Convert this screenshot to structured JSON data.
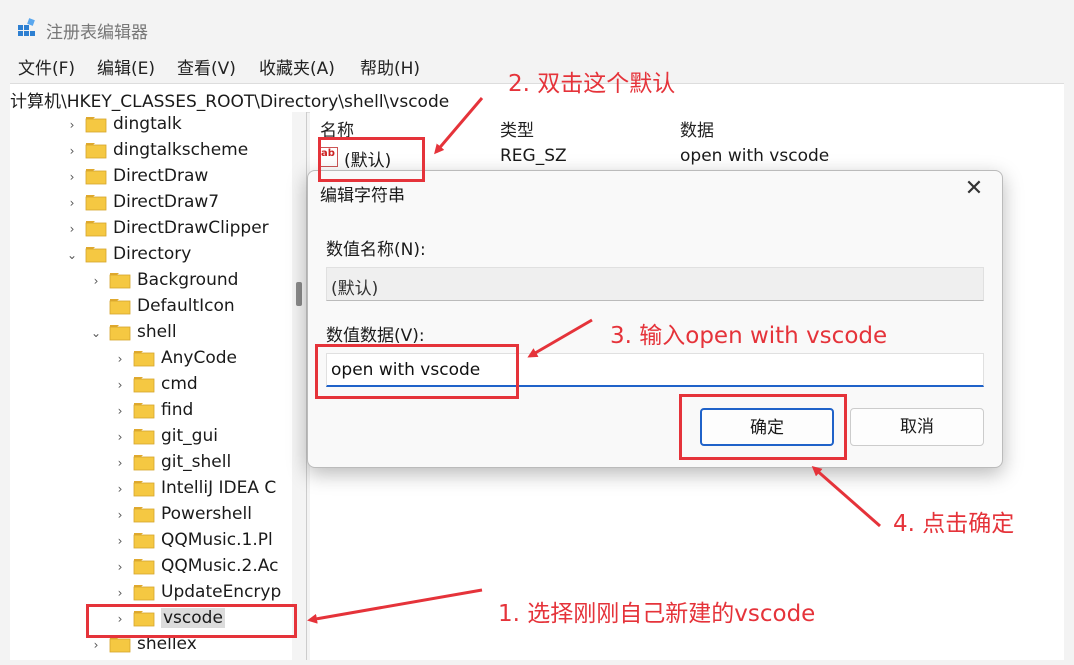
{
  "window": {
    "title": "注册表编辑器"
  },
  "menu": [
    "文件(F)",
    "编辑(E)",
    "查看(V)",
    "收藏夹(A)",
    "帮助(H)"
  ],
  "address": "计算机\\HKEY_CLASSES_ROOT\\Directory\\shell\\vscode",
  "tree": [
    {
      "label": "dingtalk",
      "chevron": "›"
    },
    {
      "label": "dingtalkscheme",
      "chevron": "›"
    },
    {
      "label": "DirectDraw",
      "chevron": "›"
    },
    {
      "label": "DirectDraw7",
      "chevron": "›"
    },
    {
      "label": "DirectDrawClipper",
      "chevron": "›"
    },
    {
      "label": "Directory",
      "chevron": "⌄"
    },
    {
      "label": "Background",
      "chevron": "›"
    },
    {
      "label": "DefaultIcon",
      "chevron": ""
    },
    {
      "label": "shell",
      "chevron": "⌄"
    },
    {
      "label": "AnyCode",
      "chevron": "›"
    },
    {
      "label": "cmd",
      "chevron": "›"
    },
    {
      "label": "find",
      "chevron": "›"
    },
    {
      "label": "git_gui",
      "chevron": "›"
    },
    {
      "label": "git_shell",
      "chevron": "›"
    },
    {
      "label": "IntelliJ IDEA C",
      "chevron": "›"
    },
    {
      "label": "Powershell",
      "chevron": "›"
    },
    {
      "label": "QQMusic.1.Pl",
      "chevron": "›"
    },
    {
      "label": "QQMusic.2.Ac",
      "chevron": "›"
    },
    {
      "label": "UpdateEncryp",
      "chevron": "›"
    },
    {
      "label": "vscode",
      "chevron": "›"
    },
    {
      "label": "shellex",
      "chevron": "›"
    }
  ],
  "values": {
    "headers": [
      "名称",
      "类型",
      "数据"
    ],
    "row": {
      "icon_text": "ab",
      "name": "(默认)",
      "type": "REG_SZ",
      "data": "open with vscode"
    }
  },
  "dialog": {
    "title": "编辑字符串",
    "close_glyph": "✕",
    "name_label": "数值名称(N):",
    "name_value": "(默认)",
    "data_label": "数值数据(V):",
    "data_value": "open with vscode",
    "ok_label": "确定",
    "cancel_label": "取消"
  },
  "annotations": {
    "step1": "1. 选择刚刚自己新建的vscode",
    "step2": "2. 双击这个默认",
    "step3": "3. 输入open with vscode",
    "step4": "4. 点击确定",
    "color": "#e5333a"
  },
  "colors": {
    "folder": "#f5c842",
    "accent": "#1f62c9"
  }
}
